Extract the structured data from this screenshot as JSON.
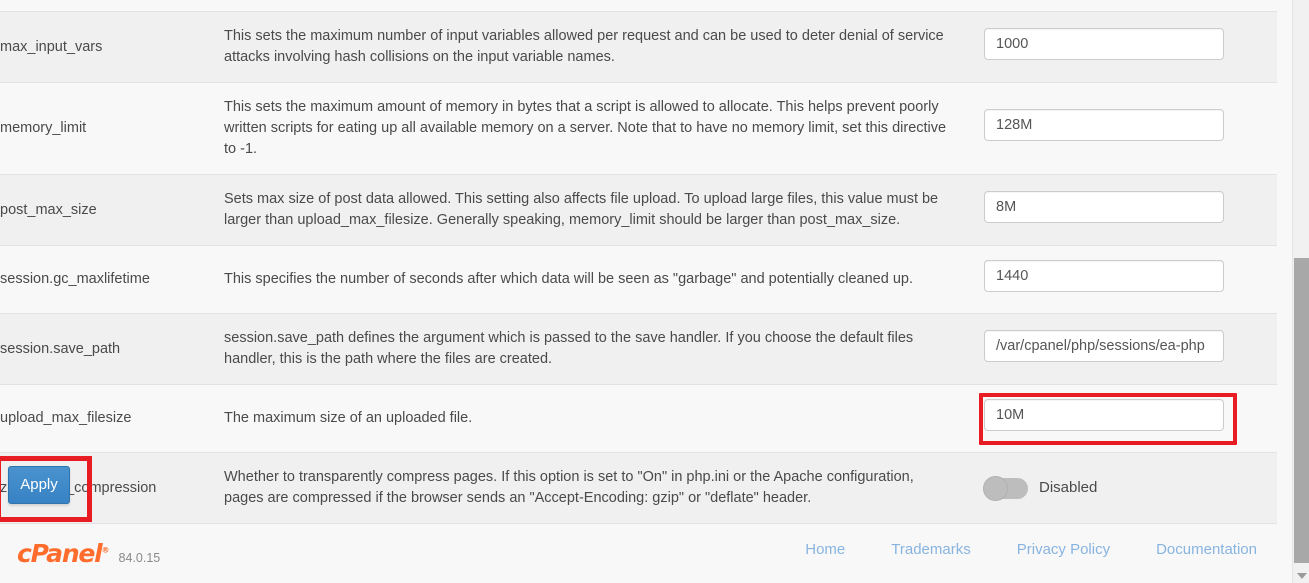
{
  "table": {
    "rows": [
      {
        "name": "max_input_vars",
        "desc_lines": [
          "This sets the maximum number of input variables allowed per request and can be used to deter denial of service",
          "attacks involving hash collisions on the input variable names."
        ],
        "control": "input",
        "value": "1000",
        "highlighted": false,
        "shaded": true
      },
      {
        "name": "memory_limit",
        "desc_lines": [
          "This sets the maximum amount of memory in bytes that a script is allowed to allocate. This helps prevent poorly",
          "written scripts for eating up all available memory on a server. Note that to have no memory limit, set this directive",
          "to -1."
        ],
        "control": "input",
        "value": "128M",
        "highlighted": false,
        "shaded": false
      },
      {
        "name": "post_max_size",
        "desc_lines": [
          "Sets max size of post data allowed. This setting also affects file upload. To upload large files, this value must be",
          "larger than upload_max_filesize. Generally speaking, memory_limit should be larger than post_max_size."
        ],
        "control": "input",
        "value": "8M",
        "highlighted": false,
        "shaded": true
      },
      {
        "name": "session.gc_maxlifetime",
        "desc_lines": [
          "This specifies the number of seconds after which data will be seen as \"garbage\" and potentially cleaned up."
        ],
        "control": "input",
        "value": "1440",
        "highlighted": false,
        "shaded": false
      },
      {
        "name": "session.save_path",
        "desc_lines": [
          "session.save_path defines the argument which is passed to the save handler. If you choose the default files",
          "handler, this is the path where the files are created."
        ],
        "control": "input",
        "value": "/var/cpanel/php/sessions/ea-php",
        "highlighted": false,
        "shaded": true
      },
      {
        "name": "upload_max_filesize",
        "desc_lines": [
          "The maximum size of an uploaded file."
        ],
        "control": "input",
        "value": "10M",
        "highlighted": true,
        "shaded": false
      },
      {
        "name": "zlib.output_compression",
        "desc_lines": [
          "Whether to transparently compress pages. If this option is set to \"On\" in php.ini or the Apache configuration,",
          "pages are compressed if the browser sends an \"Accept-Encoding: gzip\" or \"deflate\" header."
        ],
        "control": "toggle",
        "value": "Disabled",
        "highlighted": false,
        "shaded": true
      }
    ]
  },
  "actions": {
    "apply_label": "Apply"
  },
  "footer": {
    "brand": "cPanel",
    "brand_mark": "®",
    "version": "84.0.15",
    "links": [
      {
        "label": "Home"
      },
      {
        "label": "Trademarks"
      },
      {
        "label": "Privacy Policy"
      },
      {
        "label": "Documentation"
      }
    ]
  },
  "scrollbar": {
    "down_arrow_icon": "chevron-down-icon"
  },
  "colors": {
    "highlight_red": "#e81c23",
    "button_blue": "#3f8ccb",
    "brand_orange": "#ff6c2c",
    "link_blue": "#88b4e0",
    "row_shaded": "#f0f0f0",
    "row_plain": "#f8f8f8"
  }
}
